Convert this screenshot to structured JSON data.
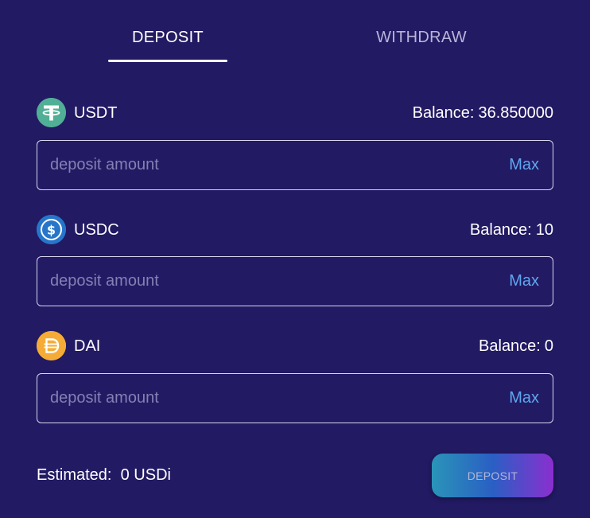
{
  "tabs": {
    "deposit": "DEPOSIT",
    "withdraw": "WITHDRAW",
    "active": "deposit"
  },
  "tokens": [
    {
      "icon": "tether-icon",
      "name": "USDT",
      "balance_label": "Balance:",
      "balance": "36.850000",
      "placeholder": "deposit amount",
      "max": "Max",
      "color": "#50af95"
    },
    {
      "icon": "usdc-icon",
      "name": "USDC",
      "balance_label": "Balance:",
      "balance": "10",
      "placeholder": "deposit amount",
      "max": "Max",
      "color": "#2775ca"
    },
    {
      "icon": "dai-icon",
      "name": "DAI",
      "balance_label": "Balance:",
      "balance": "0",
      "placeholder": "deposit amount",
      "max": "Max",
      "color": "#f5ac37"
    }
  ],
  "footer": {
    "estimated_label": "Estimated:",
    "estimated_value": "0 USDi",
    "deposit_button": "DEPOSIT"
  },
  "colors": {
    "background": "#221a63",
    "max_link": "#5fa7ef",
    "button_gradient_start": "#2a94b8",
    "button_gradient_end": "#8a2fcf"
  }
}
